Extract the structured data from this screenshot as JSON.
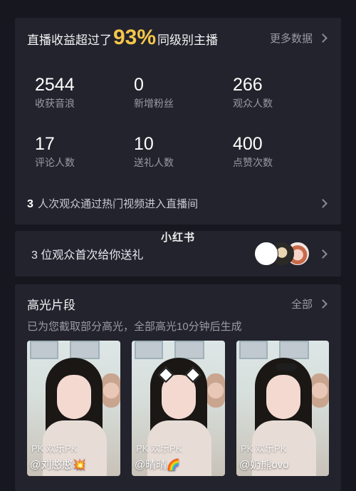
{
  "stats": {
    "headline_prefix": "直播收益超过了",
    "headline_percent": "93%",
    "headline_suffix": "同级别主播",
    "more_label": "更多数据",
    "metrics": [
      {
        "value": "2544",
        "label": "收获音浪"
      },
      {
        "value": "0",
        "label": "新增粉丝"
      },
      {
        "value": "266",
        "label": "观众人数"
      },
      {
        "value": "17",
        "label": "评论人数"
      },
      {
        "value": "10",
        "label": "送礼人数"
      },
      {
        "value": "400",
        "label": "点赞次数"
      }
    ],
    "viewers_count": "3",
    "viewers_text": "人次观众通过热门视频进入直播间"
  },
  "gift": {
    "text": "3 位观众首次给你送礼"
  },
  "watermark": "小红书",
  "highlights": {
    "title": "高光片段",
    "all_label": "全部",
    "subtitle": "已为您截取部分高光，全部高光10分钟后生成",
    "clips": [
      {
        "pk": "PK 欢乐PK",
        "name": "@刘憨憨💥"
      },
      {
        "pk": "PK 欢乐PK",
        "name": "@晴晴🌈"
      },
      {
        "pk": "PK 欢乐PK",
        "name": "@奶熊ovo"
      }
    ]
  },
  "colors": {
    "background": "#17171f",
    "card": "#23232d",
    "accent_percent": "#f5c64a",
    "muted_text": "#9a9aa6"
  },
  "icons": [
    "chevron-right-icon",
    "avatar-icon"
  ]
}
